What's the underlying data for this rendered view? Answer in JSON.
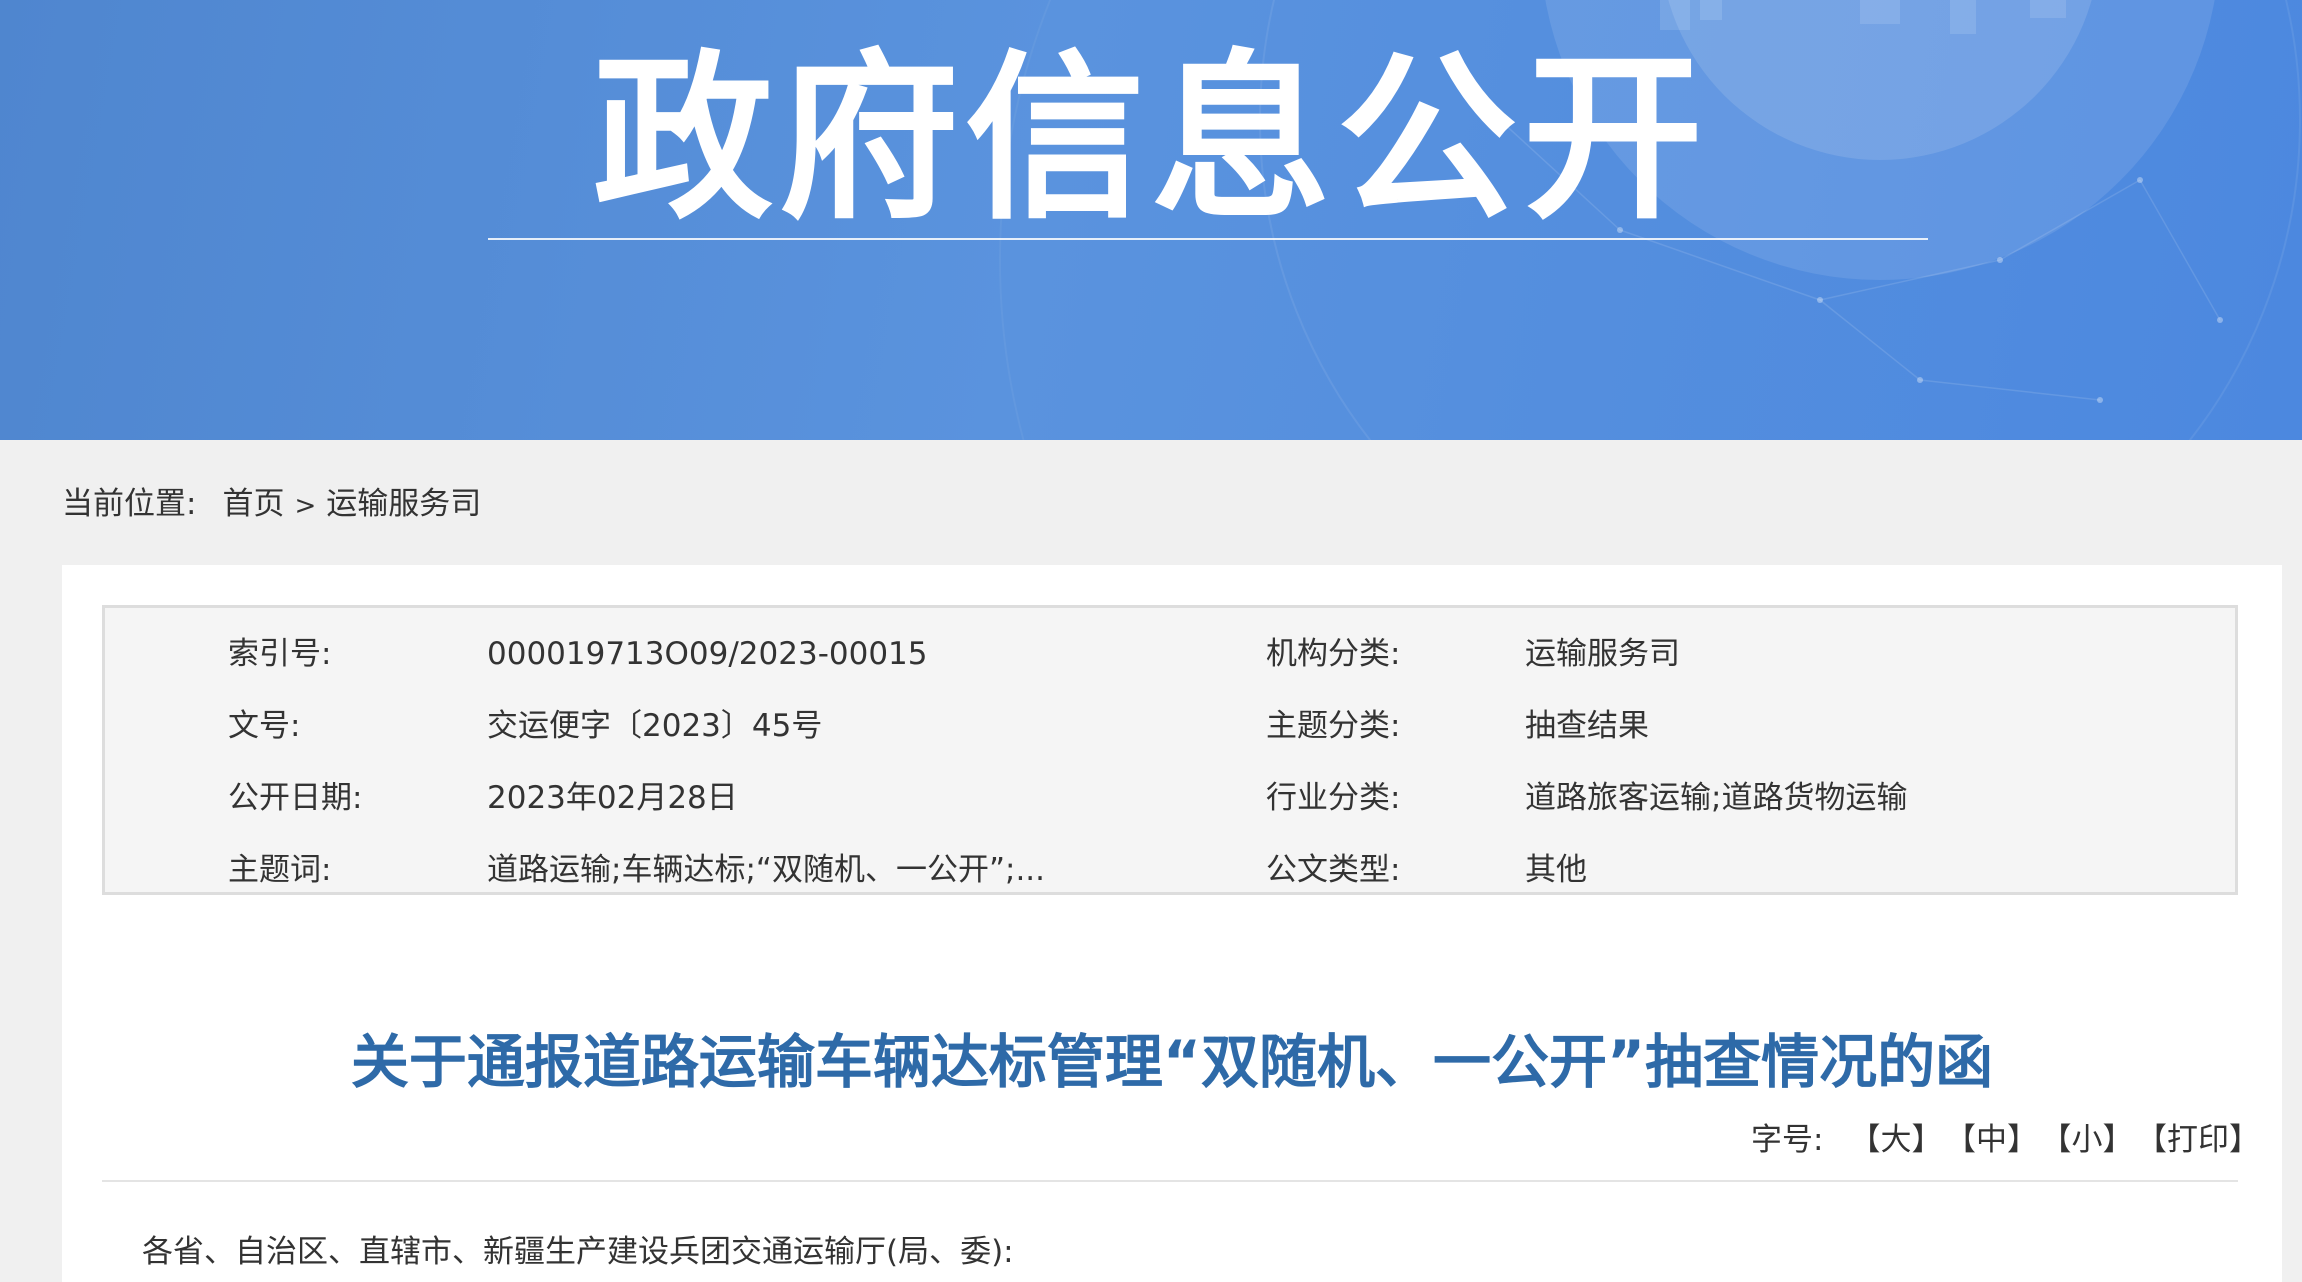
{
  "banner": {
    "title": "政府信息公开"
  },
  "breadcrumb": {
    "label": "当前位置:",
    "items": [
      "首页",
      "运输服务司"
    ],
    "separator": ">"
  },
  "meta": {
    "index_label": "索引号:",
    "index_value": "000019713O09/2023-00015",
    "org_label": "机构分类:",
    "org_value": "运输服务司",
    "docno_label": "文号:",
    "docno_value": "交运便字〔2023〕45号",
    "topic_label": "主题分类:",
    "topic_value": "抽查结果",
    "date_label": "公开日期:",
    "date_value": "2023年02月28日",
    "industry_label": "行业分类:",
    "industry_value": "道路旅客运输;道路货物运输",
    "keywords_label": "主题词:",
    "keywords_value": "道路运输;车辆达标;“双随机、一公开”;...",
    "doctype_label": "公文类型:",
    "doctype_value": "其他"
  },
  "document": {
    "title": "关于通报道路运输车辆达标管理“双随机、一公开”抽查情况的函",
    "salutation": "各省、自治区、直辖市、新疆生产建设兵团交通运输厅(局、委):"
  },
  "font_tools": {
    "label": "字号:",
    "large": "【大】",
    "medium": "【中】",
    "small": "【小】",
    "print": "【打印】"
  },
  "colors": {
    "banner": "#4f86cf",
    "title": "#2e6aa8",
    "background": "#f0f0f0",
    "meta_box": "#f5f5f5"
  }
}
